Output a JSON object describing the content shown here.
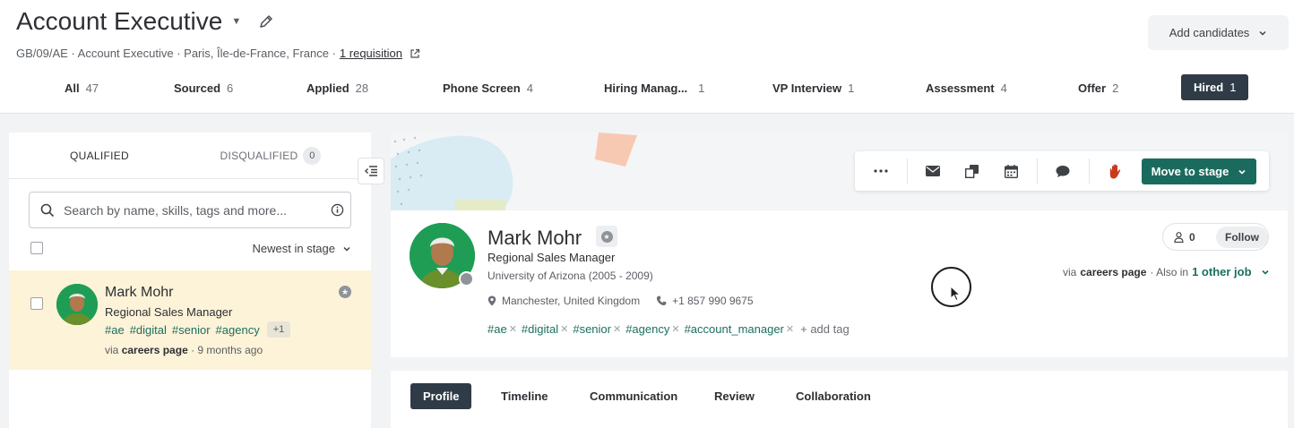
{
  "header": {
    "title": "Account Executive",
    "meta_text": "GB/09/AE · Account Executive · Paris, Île-de-France, France ·",
    "requisition_link": "1 requisition",
    "add_candidates": "Add candidates"
  },
  "stages": [
    {
      "label": "All",
      "count": "47"
    },
    {
      "label": "Sourced",
      "count": "6"
    },
    {
      "label": "Applied",
      "count": "28"
    },
    {
      "label": "Phone Screen",
      "count": "4"
    },
    {
      "label": "Hiring Manag...",
      "count": "1"
    },
    {
      "label": "VP Interview",
      "count": "1"
    },
    {
      "label": "Assessment",
      "count": "4"
    },
    {
      "label": "Offer",
      "count": "2"
    },
    {
      "label": "Hired",
      "count": "1",
      "active": true
    }
  ],
  "left": {
    "tab_qualified": "QUALIFIED",
    "tab_disqualified": "DISQUALIFIED",
    "disqualified_count": "0",
    "search_placeholder": "Search by name, skills, tags and more...",
    "sort_label": "Newest in stage",
    "candidate": {
      "name": "Mark Mohr",
      "role": "Regional Sales Manager",
      "tags": [
        "#ae",
        "#digital",
        "#senior",
        "#agency"
      ],
      "more_tags": "+1",
      "source_prefix": "via",
      "source": "careers page",
      "source_time": "· 9 months ago"
    }
  },
  "toolbar": {
    "move_to_stage": "Move to stage"
  },
  "profile": {
    "name": "Mark Mohr",
    "role": "Regional Sales Manager",
    "education": "University of Arizona (2005 - 2009)",
    "location": "Manchester, United Kingdom",
    "phone": "+1 857 990 9675",
    "tags": [
      "#ae",
      "#digital",
      "#senior",
      "#agency",
      "#account_manager"
    ],
    "add_tag": "+ add tag",
    "follower_count": "0",
    "follow_label": "Follow",
    "source_prefix": "via",
    "source": "careers page",
    "also_in": "· Also in",
    "other_job": "1 other job"
  },
  "profile_tabs": [
    "Profile",
    "Timeline",
    "Communication",
    "Review",
    "Collaboration"
  ],
  "colors": {
    "primary_green": "#1a6b5e",
    "dark_tab": "#2f3b46",
    "highlight_row": "#fdf3d8",
    "tag_green": "#1a6f5f"
  }
}
